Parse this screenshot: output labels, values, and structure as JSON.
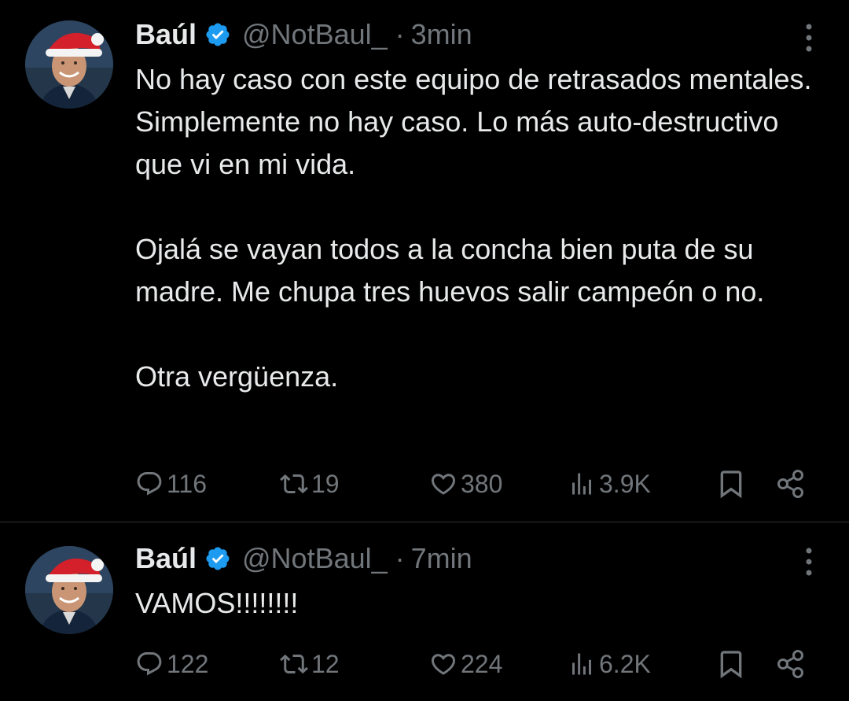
{
  "colors": {
    "background": "#000000",
    "text_primary": "#e7e9ea",
    "text_secondary": "#71767b",
    "verified_badge": "#1d9bf0",
    "divider": "#2f3336"
  },
  "tweets": [
    {
      "author": {
        "display_name": "Baúl",
        "verified_icon": "verified-badge-icon",
        "handle": "@NotBaul_",
        "separator": "·",
        "time": "3min"
      },
      "paragraphs": [
        "No hay caso con este equipo de retrasados mentales. Simplemente no hay caso. Lo más auto-destructivo que vi en mi vida.",
        "Ojalá se vayan todos a la concha bien puta de su madre. Me chupa tres huevos salir campeón o no.",
        "Otra vergüenza."
      ],
      "actions": {
        "replies": "116",
        "retweets": "19",
        "likes": "380",
        "views": "3.9K"
      }
    },
    {
      "author": {
        "display_name": "Baúl",
        "verified_icon": "verified-badge-icon",
        "handle": "@NotBaul_",
        "separator": "·",
        "time": "7min"
      },
      "paragraphs": [
        "VAMOS!!!!!!!!"
      ],
      "actions": {
        "replies": "122",
        "retweets": "12",
        "likes": "224",
        "views": "6.2K"
      }
    }
  ]
}
